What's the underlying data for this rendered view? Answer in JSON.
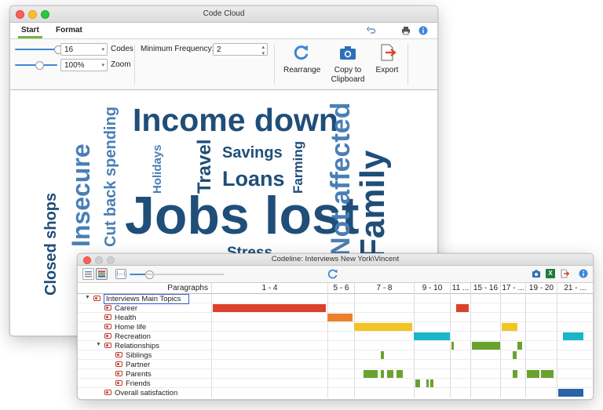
{
  "codecloud": {
    "title": "Code Cloud",
    "tabs": [
      "Start",
      "Format"
    ],
    "codes_value": "16",
    "codes_label": "Codes",
    "zoom_value": "100%",
    "zoom_label": "Zoom",
    "minfreq_label": "Minimum Frequency:",
    "minfreq_value": "2",
    "buttons": {
      "rearrange": "Rearrange",
      "copy_line1": "Copy to",
      "copy_line2": "Clipboard",
      "export": "Export"
    },
    "icons": [
      "undo-icon",
      "print-icon",
      "info-icon"
    ],
    "words": {
      "income_down": "Income down",
      "jobs_lost": "Jobs lost",
      "savings": "Savings",
      "loans": "Loans",
      "stress": "Stress",
      "travel": "Travel",
      "holidays": "Holidays",
      "farming": "Farming",
      "insecure": "Insecure",
      "cut_back": "Cut back spending",
      "closed_shops": "Closed shops",
      "not_affected": "Not affected",
      "family": "Family"
    },
    "colors": {
      "dark": "#1f4e79",
      "light": "#4a7fb5"
    }
  },
  "codeline": {
    "title": "Codeline: Interviews New York\\Vincent",
    "header_label": "Paragraphs",
    "columns": [
      "1 - 4",
      "5 - 6",
      "7 - 8",
      "9 - 10",
      "11 ...",
      "15 - 16",
      "17 - ...",
      "19 - 20",
      "21 - ..."
    ],
    "rows": [
      {
        "label": "Interviews Main Topics",
        "level": 0
      },
      {
        "label": "Career",
        "level": 1
      },
      {
        "label": "Health",
        "level": 1
      },
      {
        "label": "Home life",
        "level": 1
      },
      {
        "label": "Recreation",
        "level": 1
      },
      {
        "label": "Relationships",
        "level": 1
      },
      {
        "label": "Siblings",
        "level": 2
      },
      {
        "label": "Partner",
        "level": 2
      },
      {
        "label": "Parents",
        "level": 2
      },
      {
        "label": "Friends",
        "level": 2
      },
      {
        "label": "Overall satisfaction",
        "level": 1
      }
    ],
    "bar_colors": {
      "career": "#d9412a",
      "health": "#e9822a",
      "home_life": "#f2c522",
      "recreation": "#1bb5c8",
      "relationships": "#6aa22e",
      "overall": "#2a63a6"
    }
  }
}
